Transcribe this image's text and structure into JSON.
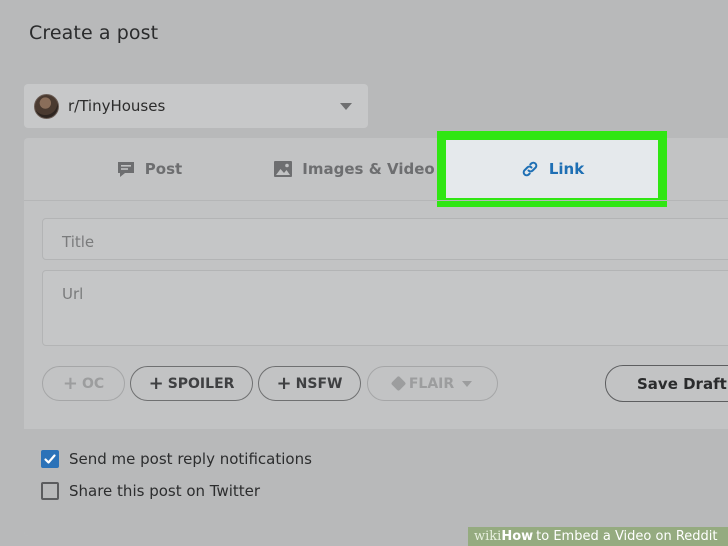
{
  "page": {
    "title": "Create a post"
  },
  "community": {
    "name": "r/TinyHouses"
  },
  "tabs": [
    {
      "label": "Post",
      "icon": "post-icon"
    },
    {
      "label": "Images & Video",
      "icon": "image-icon"
    },
    {
      "label": "Link",
      "icon": "link-icon",
      "selected": true
    }
  ],
  "form": {
    "title_placeholder": "Title",
    "url_placeholder": "Url"
  },
  "tags": {
    "oc": "OC",
    "spoiler": "SPOILER",
    "nsfw": "NSFW",
    "flair": "FLAIR",
    "plus": "+"
  },
  "actions": {
    "save_draft": "Save Draft"
  },
  "options": {
    "notifications_label": "Send me post reply notifications",
    "notifications_checked": true,
    "share_twitter_label": "Share this post on Twitter",
    "share_twitter_checked": false
  },
  "watermark": {
    "wiki": "wiki",
    "how": "How",
    "rest": "to Embed a Video on Reddit"
  },
  "colors": {
    "highlight": "#30e613",
    "link_blue": "#1e6fb4",
    "checkbox_blue": "#2b72b8"
  }
}
